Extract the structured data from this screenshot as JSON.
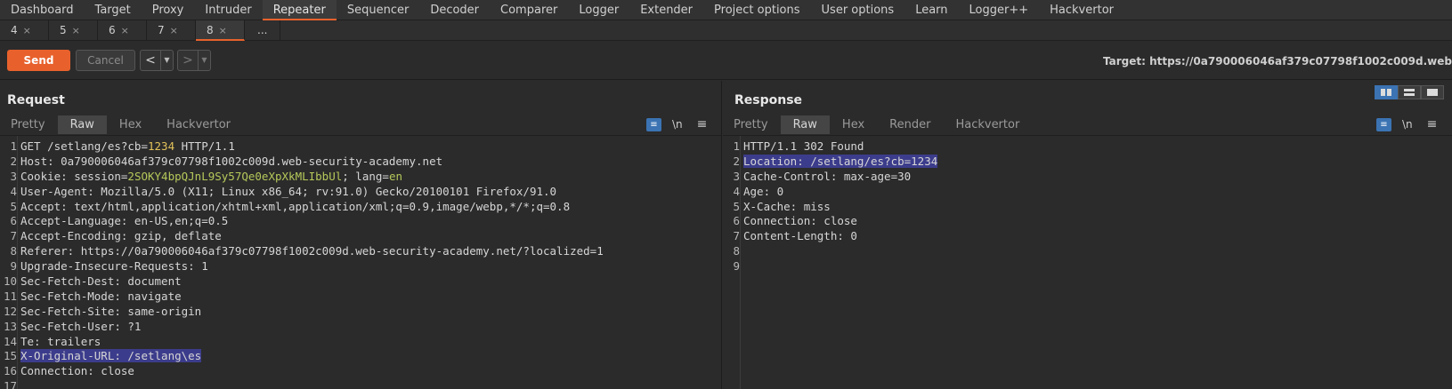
{
  "top_tabs": [
    "Dashboard",
    "Target",
    "Proxy",
    "Intruder",
    "Repeater",
    "Sequencer",
    "Decoder",
    "Comparer",
    "Logger",
    "Extender",
    "Project options",
    "User options",
    "Learn",
    "Logger++",
    "Hackvertor"
  ],
  "top_active": "Repeater",
  "sub_tabs": [
    {
      "label": "4",
      "close": "×"
    },
    {
      "label": "5",
      "close": "×"
    },
    {
      "label": "6",
      "close": "×"
    },
    {
      "label": "7",
      "close": "×"
    },
    {
      "label": "8",
      "close": "×",
      "active": true
    }
  ],
  "sub_more": "...",
  "toolbar": {
    "send": "Send",
    "cancel": "Cancel",
    "back_arrow": "<",
    "fwd_arrow": ">",
    "dropdown": "▼",
    "target": "Target: https://0a790006046af379c07798f1002c009d.web"
  },
  "request": {
    "title": "Request",
    "tabs": [
      "Pretty",
      "Raw",
      "Hex",
      "Hackvertor"
    ],
    "active_tab": "Raw",
    "wrap_icon": "≡",
    "newline_label": "\\n",
    "menu_icon": "≡",
    "lines": [
      {
        "n": "1",
        "parts": [
          {
            "t": "GET /setlang/es?cb="
          },
          {
            "t": "1234",
            "c": "num"
          },
          {
            "t": " HTTP/1.1"
          }
        ]
      },
      {
        "n": "2",
        "parts": [
          {
            "t": "Host: 0a790006046af379c07798f1002c009d.web-security-academy.net"
          }
        ]
      },
      {
        "n": "3",
        "parts": [
          {
            "t": "Cookie: session="
          },
          {
            "t": "2SOKY4bpQJnL9Sy57Qe0eXpXkMLIbbUl",
            "c": "grn"
          },
          {
            "t": "; lang="
          },
          {
            "t": "en",
            "c": "grn"
          }
        ]
      },
      {
        "n": "4",
        "parts": [
          {
            "t": "User-Agent: Mozilla/5.0 (X11; Linux x86_64; rv:91.0) Gecko/20100101 Firefox/91.0"
          }
        ]
      },
      {
        "n": "5",
        "parts": [
          {
            "t": "Accept: text/html,application/xhtml+xml,application/xml;q=0.9,image/webp,*/*;q=0.8"
          }
        ]
      },
      {
        "n": "6",
        "parts": [
          {
            "t": "Accept-Language: en-US,en;q=0.5"
          }
        ]
      },
      {
        "n": "7",
        "parts": [
          {
            "t": "Accept-Encoding: gzip, deflate"
          }
        ]
      },
      {
        "n": "8",
        "parts": [
          {
            "t": "Referer: https://0a790006046af379c07798f1002c009d.web-security-academy.net/?localized=1"
          }
        ]
      },
      {
        "n": "9",
        "parts": [
          {
            "t": "Upgrade-Insecure-Requests: 1"
          }
        ]
      },
      {
        "n": "10",
        "parts": [
          {
            "t": "Sec-Fetch-Dest: document"
          }
        ]
      },
      {
        "n": "11",
        "parts": [
          {
            "t": "Sec-Fetch-Mode: navigate"
          }
        ]
      },
      {
        "n": "12",
        "parts": [
          {
            "t": "Sec-Fetch-Site: same-origin"
          }
        ]
      },
      {
        "n": "13",
        "parts": [
          {
            "t": "Sec-Fetch-User: ?1"
          }
        ]
      },
      {
        "n": "14",
        "parts": [
          {
            "t": "Te: trailers"
          }
        ]
      },
      {
        "n": "15",
        "parts": [
          {
            "t": "X-Original-URL: /setlang\\es",
            "c": "hl"
          }
        ]
      },
      {
        "n": "16",
        "parts": [
          {
            "t": "Connection: close"
          }
        ]
      },
      {
        "n": "17",
        "parts": [
          {
            "t": ""
          }
        ]
      }
    ]
  },
  "response": {
    "title": "Response",
    "tabs": [
      "Pretty",
      "Raw",
      "Hex",
      "Render",
      "Hackvertor"
    ],
    "active_tab": "Raw",
    "wrap_icon": "≡",
    "newline_label": "\\n",
    "menu_icon": "≡",
    "lines": [
      {
        "n": "1",
        "parts": [
          {
            "t": "HTTP/1.1 302 Found"
          }
        ]
      },
      {
        "n": "2",
        "parts": [
          {
            "t": "Location: /setlang/es?cb=1234",
            "c": "hl"
          }
        ]
      },
      {
        "n": "3",
        "parts": [
          {
            "t": "Cache-Control: max-age=30"
          }
        ]
      },
      {
        "n": "4",
        "parts": [
          {
            "t": "Age: 0"
          }
        ]
      },
      {
        "n": "5",
        "parts": [
          {
            "t": "X-Cache: miss"
          }
        ]
      },
      {
        "n": "6",
        "parts": [
          {
            "t": "Connection: close"
          }
        ]
      },
      {
        "n": "7",
        "parts": [
          {
            "t": "Content-Length: 0"
          }
        ]
      },
      {
        "n": "8",
        "parts": [
          {
            "t": ""
          }
        ]
      },
      {
        "n": "9",
        "parts": [
          {
            "t": ""
          }
        ]
      }
    ]
  },
  "colors": {
    "accent": "#e8612c",
    "selected_blue": "#3b73b3",
    "highlight": "#3c3c8c"
  }
}
